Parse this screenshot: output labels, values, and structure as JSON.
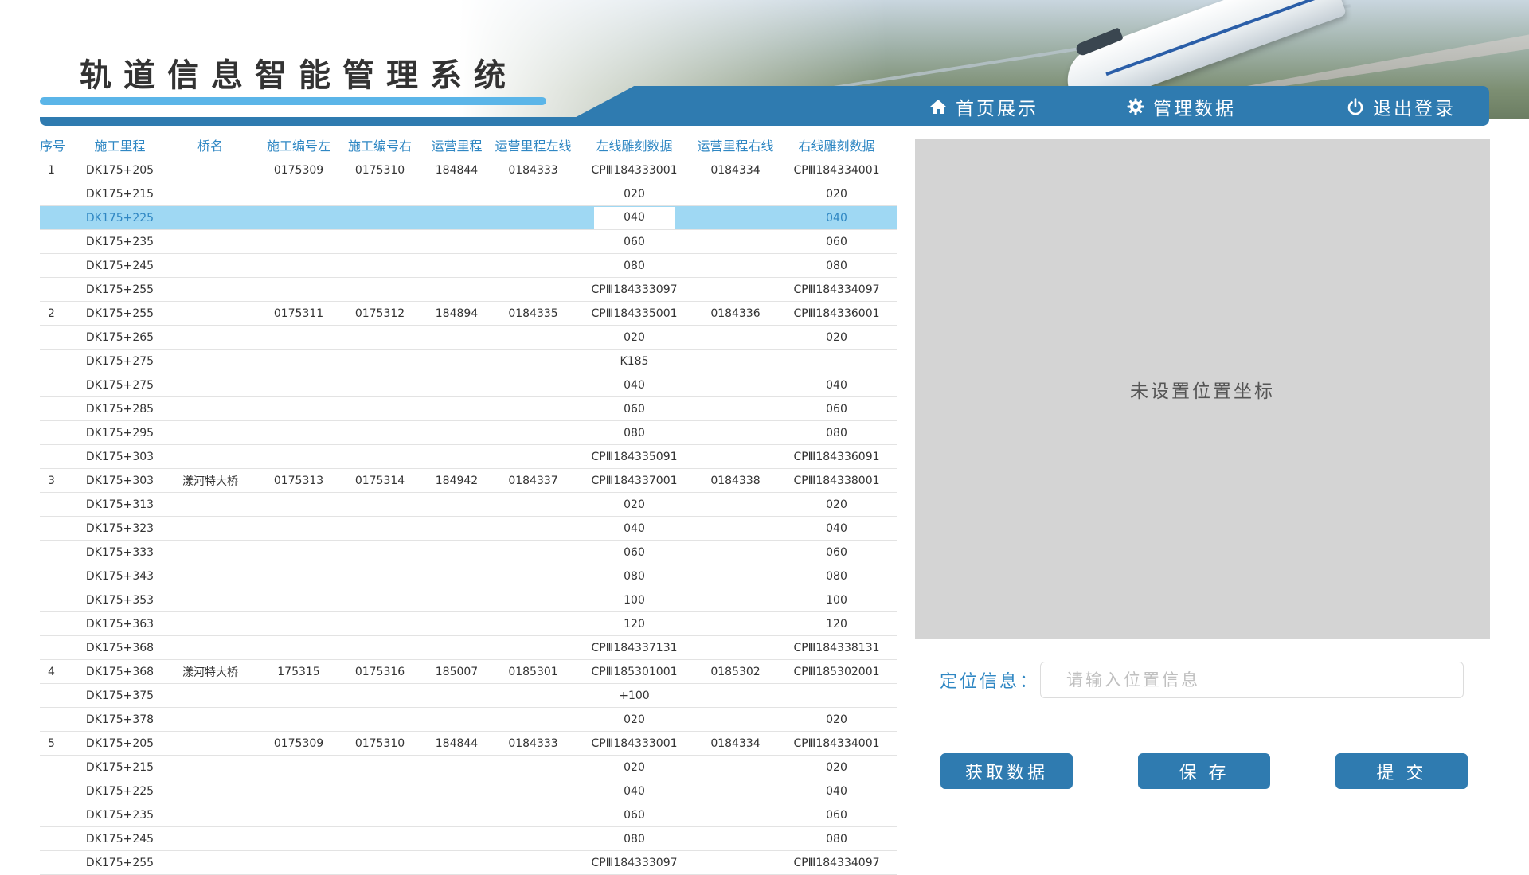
{
  "app": {
    "title": "轨道信息智能管理系统"
  },
  "nav": {
    "home": "首页展示",
    "manage": "管理数据",
    "logout": "退出登录"
  },
  "table": {
    "columns": [
      "序号",
      "施工里程",
      "桥名",
      "施工编号左",
      "施工编号右",
      "运营里程",
      "运营里程左线",
      "左线雕刻数据",
      "运营里程右线",
      "右线雕刻数据"
    ],
    "rows": [
      [
        "1",
        "DK175+205",
        "",
        "0175309",
        "0175310",
        "184844",
        "0184333",
        "CPⅢ184333001",
        "0184334",
        "CPⅢ184334001"
      ],
      [
        "",
        "DK175+215",
        "",
        "",
        "",
        "",
        "",
        "020",
        "",
        "020"
      ],
      [
        "",
        "DK175+225",
        "",
        "",
        "",
        "",
        "",
        "040",
        "",
        "040"
      ],
      [
        "",
        "DK175+235",
        "",
        "",
        "",
        "",
        "",
        "060",
        "",
        "060"
      ],
      [
        "",
        "DK175+245",
        "",
        "",
        "",
        "",
        "",
        "080",
        "",
        "080"
      ],
      [
        "",
        "DK175+255",
        "",
        "",
        "",
        "",
        "",
        "CPⅢ184333097",
        "",
        "CPⅢ184334097"
      ],
      [
        "2",
        "DK175+255",
        "",
        "0175311",
        "0175312",
        "184894",
        "0184335",
        "CPⅢ184335001",
        "0184336",
        "CPⅢ184336001"
      ],
      [
        "",
        "DK175+265",
        "",
        "",
        "",
        "",
        "",
        "020",
        "",
        "020"
      ],
      [
        "",
        "DK175+275",
        "",
        "",
        "",
        "",
        "",
        "K185",
        "",
        ""
      ],
      [
        "",
        "DK175+275",
        "",
        "",
        "",
        "",
        "",
        "040",
        "",
        "040"
      ],
      [
        "",
        "DK175+285",
        "",
        "",
        "",
        "",
        "",
        "060",
        "",
        "060"
      ],
      [
        "",
        "DK175+295",
        "",
        "",
        "",
        "",
        "",
        "080",
        "",
        "080"
      ],
      [
        "",
        "DK175+303",
        "",
        "",
        "",
        "",
        "",
        "CPⅢ184335091",
        "",
        "CPⅢ184336091"
      ],
      [
        "3",
        "DK175+303",
        "漾河特大桥",
        "0175313",
        "0175314",
        "184942",
        "0184337",
        "CPⅢ184337001",
        "0184338",
        "CPⅢ184338001"
      ],
      [
        "",
        "DK175+313",
        "",
        "",
        "",
        "",
        "",
        "020",
        "",
        "020"
      ],
      [
        "",
        "DK175+323",
        "",
        "",
        "",
        "",
        "",
        "040",
        "",
        "040"
      ],
      [
        "",
        "DK175+333",
        "",
        "",
        "",
        "",
        "",
        "060",
        "",
        "060"
      ],
      [
        "",
        "DK175+343",
        "",
        "",
        "",
        "",
        "",
        "080",
        "",
        "080"
      ],
      [
        "",
        "DK175+353",
        "",
        "",
        "",
        "",
        "",
        "100",
        "",
        "100"
      ],
      [
        "",
        "DK175+363",
        "",
        "",
        "",
        "",
        "",
        "120",
        "",
        "120"
      ],
      [
        "",
        "DK175+368",
        "",
        "",
        "",
        "",
        "",
        "CPⅢ184337131",
        "",
        "CPⅢ184338131"
      ],
      [
        "4",
        "DK175+368",
        "漾河特大桥",
        "175315",
        "0175316",
        "185007",
        "0185301",
        "CPⅢ185301001",
        "0185302",
        "CPⅢ185302001"
      ],
      [
        "",
        "DK175+375",
        "",
        "",
        "",
        "",
        "",
        "+100",
        "",
        ""
      ],
      [
        "",
        "DK175+378",
        "",
        "",
        "",
        "",
        "",
        "020",
        "",
        "020"
      ],
      [
        "5",
        "DK175+205",
        "",
        "0175309",
        "0175310",
        "184844",
        "0184333",
        "CPⅢ184333001",
        "0184334",
        "CPⅢ184334001"
      ],
      [
        "",
        "DK175+215",
        "",
        "",
        "",
        "",
        "",
        "020",
        "",
        "020"
      ],
      [
        "",
        "DK175+225",
        "",
        "",
        "",
        "",
        "",
        "040",
        "",
        "040"
      ],
      [
        "",
        "DK175+235",
        "",
        "",
        "",
        "",
        "",
        "060",
        "",
        "060"
      ],
      [
        "",
        "DK175+245",
        "",
        "",
        "",
        "",
        "",
        "080",
        "",
        "080"
      ],
      [
        "",
        "DK175+255",
        "",
        "",
        "",
        "",
        "",
        "CPⅢ184333097",
        "",
        "CPⅢ184334097"
      ]
    ],
    "selected_row": 2
  },
  "panel": {
    "coord_text": "未设置位置坐标",
    "location_label": "定位信息：",
    "location_placeholder": "请输入位置信息",
    "location_value": ""
  },
  "actions": {
    "fetch": "获取数据",
    "save": "保 存",
    "submit": "提 交"
  },
  "colors": {
    "accent": "#2f7bb0",
    "header_text": "#2f87c3",
    "selected_row": "#9fd8f3",
    "panel_bg": "#d4d4d4"
  },
  "icons": {
    "home": "home-icon",
    "manage": "gear-icon",
    "logout": "power-icon"
  }
}
